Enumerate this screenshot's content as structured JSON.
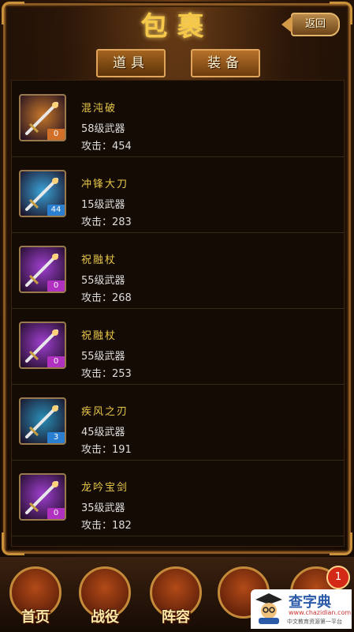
{
  "header": {
    "title": "包裹",
    "back_label": "返回"
  },
  "tabs": [
    {
      "label": "道具"
    },
    {
      "label": "装备"
    }
  ],
  "items": [
    {
      "name": "混沌破",
      "level": "58级武器",
      "attack": "攻击：454",
      "count": "0",
      "rarity_color": "#c97a2a",
      "badge_color": "#d2702a"
    },
    {
      "name": "冲锋大刀",
      "level": "15级武器",
      "attack": "攻击：283",
      "count": "44",
      "rarity_color": "#3aa3d8",
      "badge_color": "#2a7fd0"
    },
    {
      "name": "祝融杖",
      "level": "55级武器",
      "attack": "攻击：268",
      "count": "0",
      "rarity_color": "#a040d0",
      "badge_color": "#b030c0"
    },
    {
      "name": "祝融杖",
      "level": "55级武器",
      "attack": "攻击：253",
      "count": "0",
      "rarity_color": "#a040d0",
      "badge_color": "#b030c0"
    },
    {
      "name": "疾风之刃",
      "level": "45级武器",
      "attack": "攻击：191",
      "count": "3",
      "rarity_color": "#2a90b8",
      "badge_color": "#2a7fd0"
    },
    {
      "name": "龙吟宝剑",
      "level": "35级武器",
      "attack": "攻击：182",
      "count": "0",
      "rarity_color": "#a040d0",
      "badge_color": "#b030c0"
    }
  ],
  "bottom_nav": [
    {
      "label": "首页",
      "icon": "palace-icon"
    },
    {
      "label": "战役",
      "icon": "crossed-swords-icon"
    },
    {
      "label": "阵容",
      "icon": "castle-icon"
    },
    {
      "label": "",
      "icon": "general-icon"
    },
    {
      "label": "",
      "icon": "chest-icon"
    }
  ],
  "notification_count": "1",
  "watermark": {
    "title": "查字典",
    "url": "www.chazidian.com",
    "tagline": "中文教育资源第一平台"
  }
}
